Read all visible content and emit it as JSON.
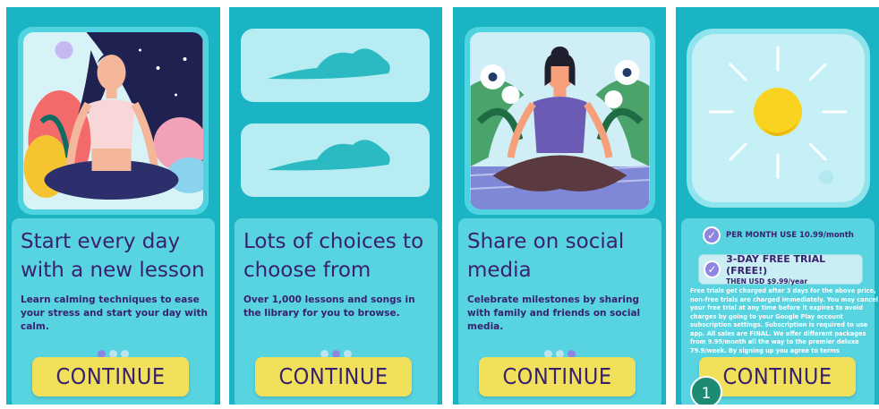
{
  "screens": [
    {
      "title": "Start every day with a new lesson",
      "description": "Learn calming techniques to ease your stress and start your day with calm.",
      "continue_label": "CONTINUE",
      "active_dot": 0
    },
    {
      "title": "Lots of choices to choose from",
      "description": "Over 1,000 lessons and songs in the library for you to browse.",
      "continue_label": "CONTINUE",
      "active_dot": 1
    },
    {
      "title": "Share on social media",
      "description": "Celebrate milestones by sharing with family and friends on social media.",
      "continue_label": "CONTINUE",
      "active_dot": 2
    },
    {
      "subscription": {
        "option1_label": "PER MONTH USE 10.99/month",
        "option2_title": "3-DAY FREE TRIAL (FREE!)",
        "option2_sub": "THEN USD $9.99/year",
        "terms": "Free trials get charged after 3 days for the above price, non-free trials are charged immediately. You may cancel your free trial at any time before it expires to avoid charges by going to your Google Play account subscription settings. Subscription is required to use app. All sales are FINAL. We offer different packages from 9.99/month all the way to the premier deluxe 79.9/week. By signing up you agree to terms"
      },
      "continue_label": "CONTINUE",
      "badge": "1"
    }
  ],
  "colors": {
    "panel_bg": "#1ab4c4",
    "card_bg": "#58d3e0",
    "text_purple": "#3a2170",
    "button_yellow": "#f1e15a",
    "dot_active": "#8f86e2",
    "dot_inactive": "#bde3ee",
    "badge_green": "#1d8b74"
  },
  "icons": [
    "check-icon",
    "sun-icon",
    "cloud-icon"
  ]
}
